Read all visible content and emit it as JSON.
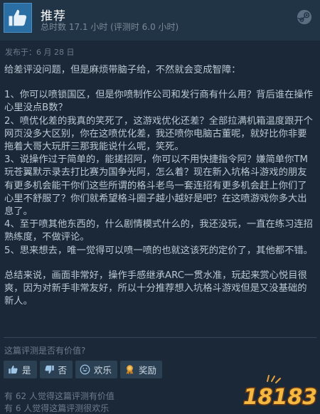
{
  "header": {
    "verdict": "推荐",
    "hours_text": "总时数 17.1 小时   (评测时 6.0 小时)"
  },
  "posted": "发布于：6 月 28 日",
  "review": {
    "paragraphs": [
      "给差评没问题，但是麻烦带脑子给，不然就会变成智障：",
      "",
      "1、你可以喷锁国区，但是你喷制作公司和发行商有什么用？背后谁在操作心里没点B数？",
      "2、喷优化差的我真的笑死了，这游戏优化还差？全部拉满机箱温度跟开个网页没多大区别，你在这喷优化差，我还喷你电脑古董呢，就好比你非要拖着大哥大玩肝三那我能说什么呢，笑死。",
      "3、说操作过于简单的，能搓招阿，你可以不用快捷指令阿？嫌简单你TM玩苍翼默示录去打比赛为国争光阿，怎么着？现在新入坑格斗游戏的朋友有更多机会能干你们这些所谓的格斗老鸟一套连招有更多机会赶上你们了心里不舒服了？你们就希望格斗圈子越小越好是吧？在这喷游戏你多大出息了。",
      "4、至于喷其他东西的，什么剧情模式什么的，我还没玩，一直在练习连招熟练度，不做评论。",
      "5、思来想去，唯一觉得可以喷一喷的也就这该死的定价了，其他都不错。",
      "",
      "总结来说，画面非常好，操作手感继承ARC一贯水准，玩起来赏心悦目很爽，因为对新手非常友好，所以十分推荐想入坑格斗游戏但是又没基础的新人。"
    ]
  },
  "helpful": {
    "question": "这篇评测是否有价值?",
    "buttons": {
      "yes": "是",
      "no": "否",
      "funny": "欢乐",
      "award": "奖励"
    },
    "stat_helpful": "有 62 人觉得这篇评测有价值",
    "stat_funny": "有 6 人觉得这篇评测很欢乐"
  },
  "watermark": {
    "text": "18183"
  },
  "colors": {
    "background": "#1b2838",
    "header": "#213446",
    "thumb_badge": "#2a6ea3",
    "button": "#2c4054",
    "award_icon": "#e8a33a"
  },
  "icons": [
    "thumbs-up-icon",
    "steam-logo-icon",
    "thumbs-down-icon",
    "laugh-icon",
    "award-icon"
  ]
}
